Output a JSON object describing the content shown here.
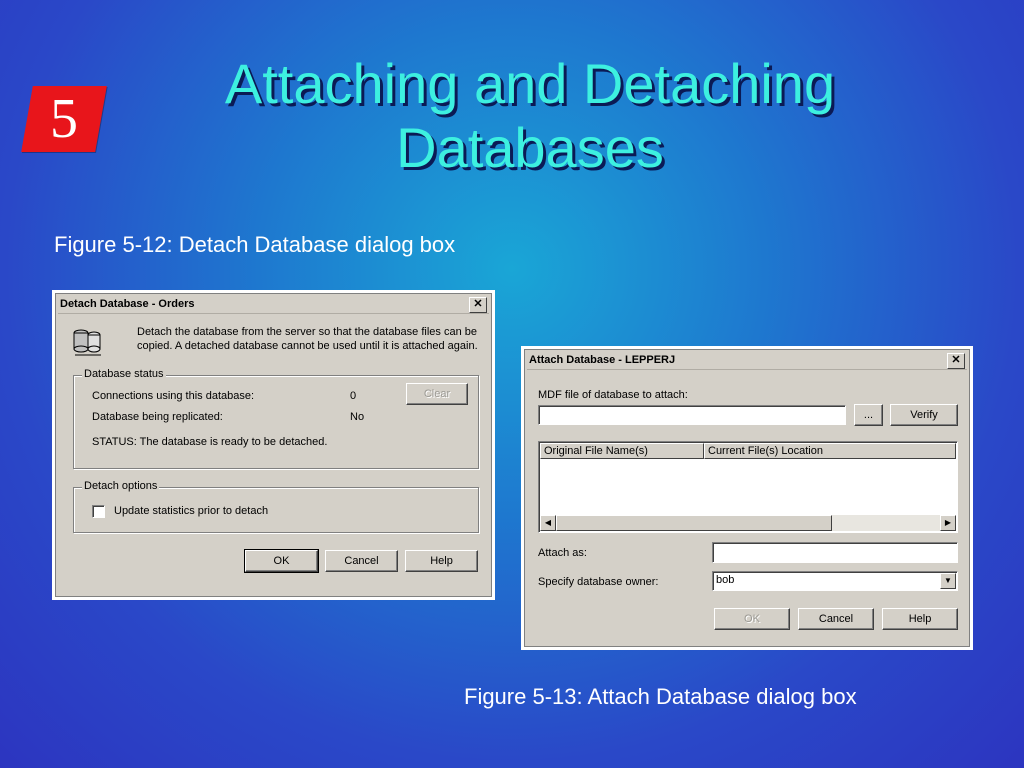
{
  "slide": {
    "chapter_number": "5",
    "title_line1": "Attaching and Detaching",
    "title_line2": "Databases",
    "caption_detach": "Figure 5-12: Detach Database dialog box",
    "caption_attach": "Figure 5-13: Attach Database dialog box",
    "colors": {
      "title": "#3df0e0",
      "badge": "#e8151b"
    }
  },
  "detach_dialog": {
    "title": "Detach Database - Orders",
    "close": "✕",
    "icon": "database-server-icon",
    "description_line1": "Detach the database from the server so that the database files can be",
    "description_line2": "copied. A detached database cannot be used until it is attached again.",
    "status_group": {
      "label": "Database status",
      "connections_label": "Connections using this database:",
      "connections_value": "0",
      "replicated_label": "Database being replicated:",
      "replicated_value": "No",
      "status_text": "STATUS:  The database is ready to be detached.",
      "clear_button": "Clear"
    },
    "options_group": {
      "label": "Detach options",
      "update_stats_label": "Update statistics prior to detach",
      "update_stats_checked": false
    },
    "buttons": {
      "ok": "OK",
      "cancel": "Cancel",
      "help": "Help"
    }
  },
  "attach_dialog": {
    "title": "Attach Database - LEPPERJ",
    "close": "✕",
    "mdf_label": "MDF file of database to attach:",
    "mdf_value": "",
    "browse_button": "...",
    "verify_button": "Verify",
    "columns": [
      "Original File Name(s)",
      "Current File(s) Location"
    ],
    "attach_as_label": "Attach as:",
    "attach_as_value": "",
    "owner_label": "Specify database owner:",
    "owner_value": "bob",
    "buttons": {
      "ok": "OK",
      "cancel": "Cancel",
      "help": "Help"
    }
  }
}
